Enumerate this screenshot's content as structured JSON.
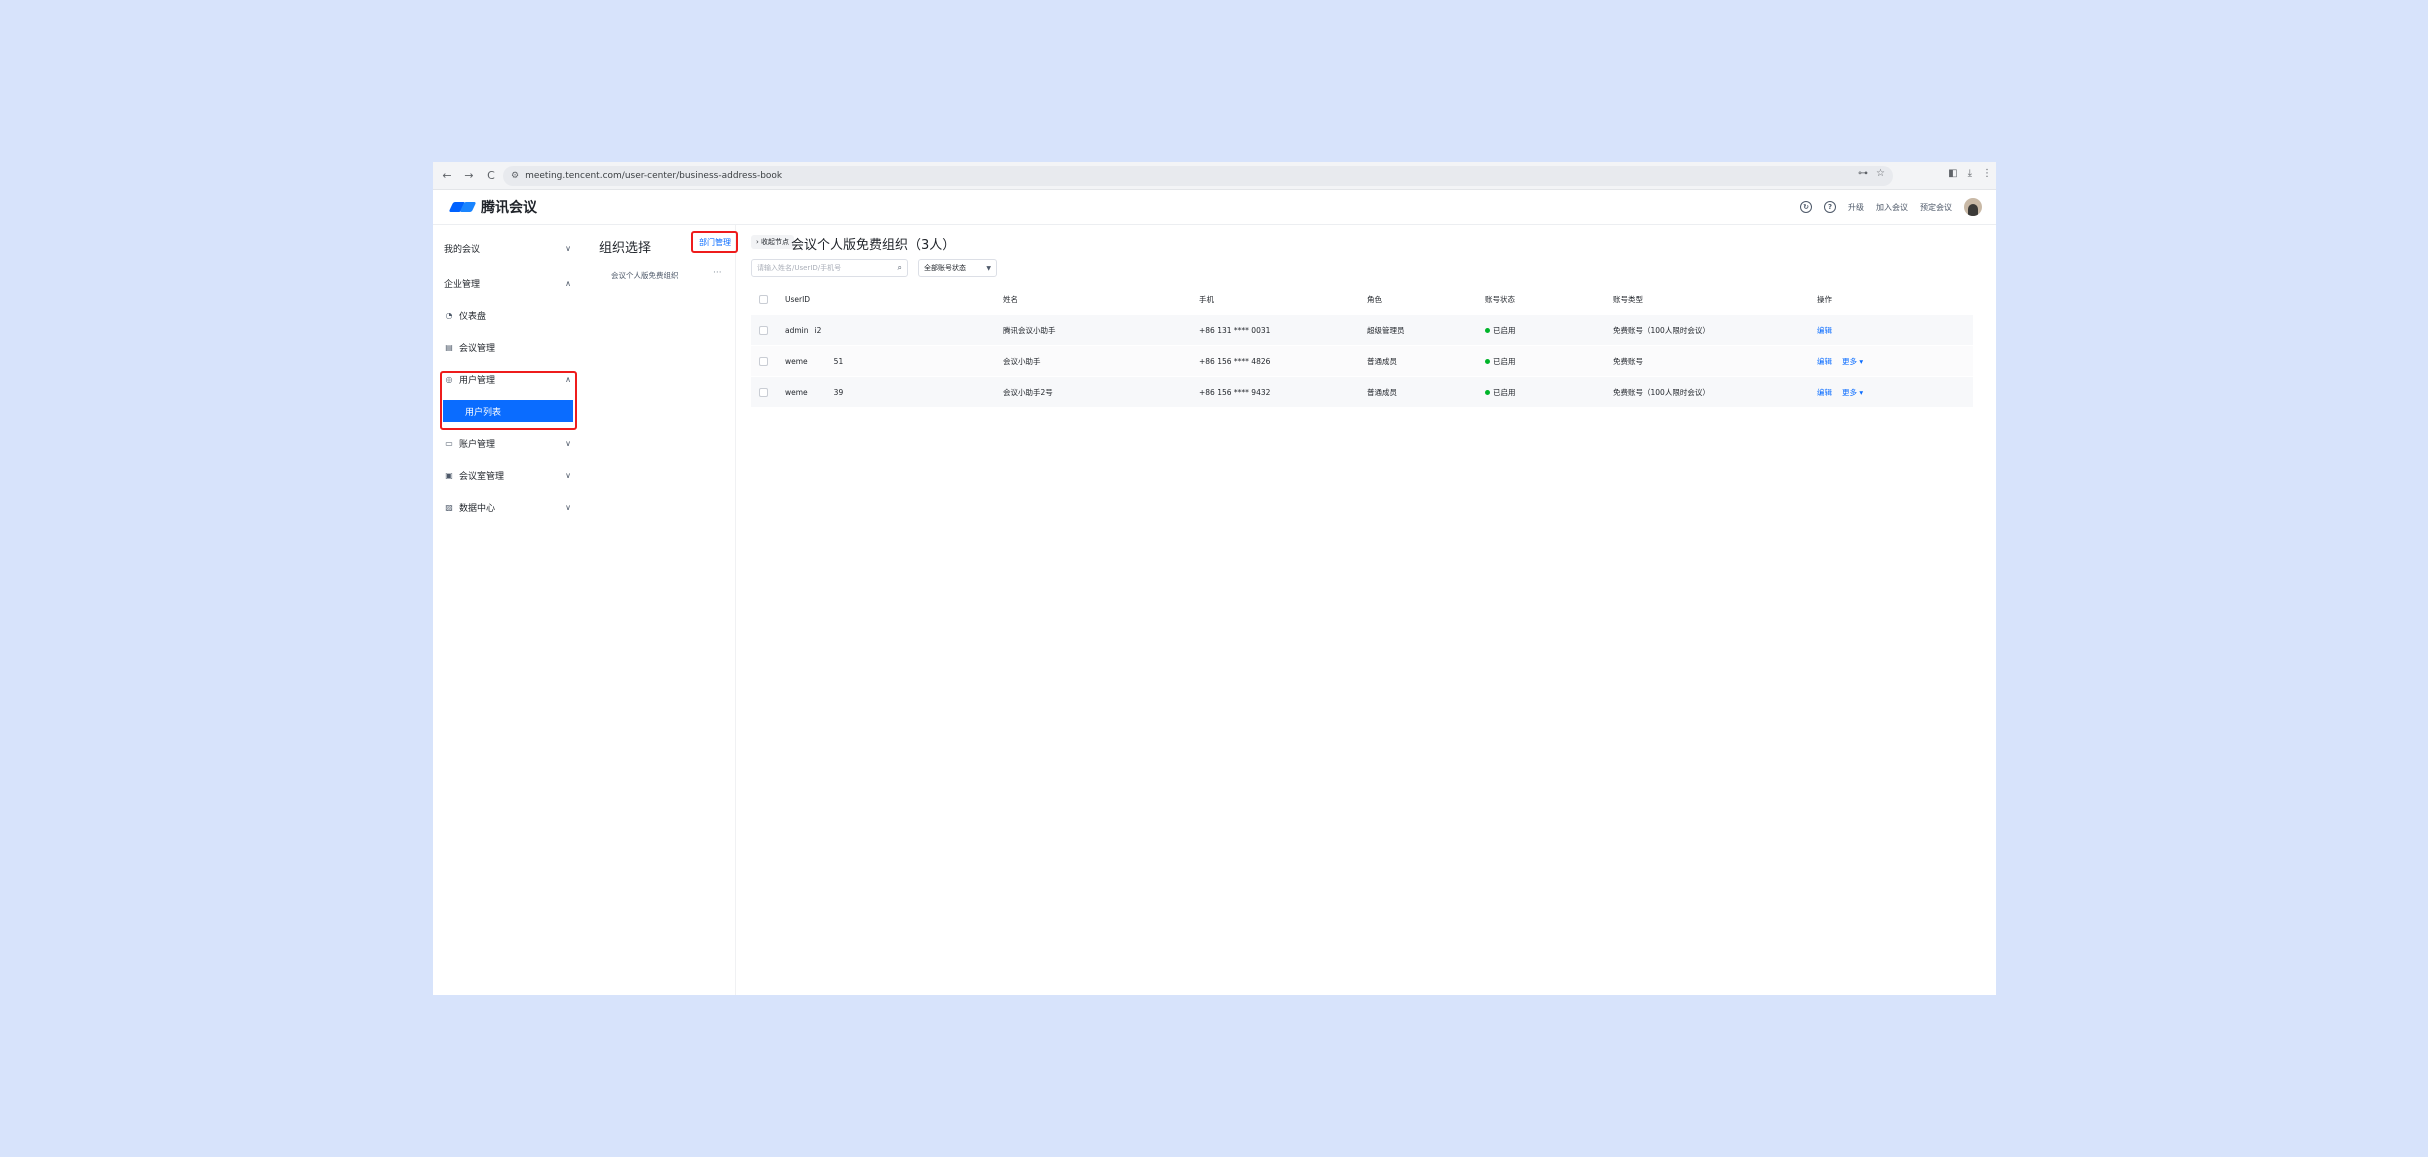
{
  "browser": {
    "url": "meeting.tencent.com/user-center/business-address-book",
    "nav_icons": [
      "back-arrow-icon",
      "forward-arrow-icon",
      "reload-icon"
    ],
    "back": "←",
    "forward": "→",
    "reload": "C",
    "site_info": "⚙",
    "key": "⊶",
    "star": "☆",
    "panel": "◧",
    "download": "⤓",
    "menu": "⋮"
  },
  "header": {
    "logo_text": "腾讯会议",
    "links": [
      "升级",
      "加入会议",
      "预定会议"
    ],
    "support_icon": "↻",
    "help_icon": "?"
  },
  "sidebar": {
    "my_meetings": "我的会议",
    "enterprise_mgmt": "企业管理",
    "dashboard": "仪表盘",
    "meeting_mgmt": "会议管理",
    "user_mgmt": "用户管理",
    "user_list": "用户列表",
    "account_mgmt": "账户管理",
    "room_mgmt": "会议室管理",
    "data_center": "数据中心",
    "collapse": "≡"
  },
  "org": {
    "title": "组织选择",
    "dept_mgmt": "部门管理",
    "node": "会议个人版免费组织",
    "more": "···"
  },
  "main": {
    "collapse_btn": "› 收起节点",
    "title": "会议个人版免费组织（3人）",
    "search_placeholder": "请输入姓名/UserID/手机号",
    "status_filter": "全部账号状态",
    "columns": {
      "userid": "UserID",
      "name": "姓名",
      "phone": "手机",
      "role": "角色",
      "status": "账号状态",
      "type": "账号类型",
      "ops": "操作"
    },
    "rows": [
      {
        "userid": "admin",
        "suffix": "i2",
        "name": "腾讯会议小助手",
        "phone": "+86 131 **** 0031",
        "role": "超级管理员",
        "status": "已启用",
        "type": "免费账号（100人限时会议）",
        "ops": [
          "编辑"
        ]
      },
      {
        "userid": "weme",
        "suffix": "51",
        "name": "会议小助手",
        "phone": "+86 156 **** 4826",
        "role": "普通成员",
        "status": "已启用",
        "type": "免费账号",
        "ops": [
          "编辑",
          "更多 ▾"
        ]
      },
      {
        "userid": "weme",
        "suffix": "39",
        "name": "会议小助手2号",
        "phone": "+86 156 **** 9432",
        "role": "普通成员",
        "status": "已启用",
        "type": "免费账号（100人限时会议）",
        "ops": [
          "编辑",
          "更多 ▾"
        ]
      }
    ]
  },
  "colors": {
    "accent": "#0a6cff",
    "highlight": "#ee1c1c",
    "enabled": "#00b42a",
    "backdrop": "#d7e3fb"
  }
}
